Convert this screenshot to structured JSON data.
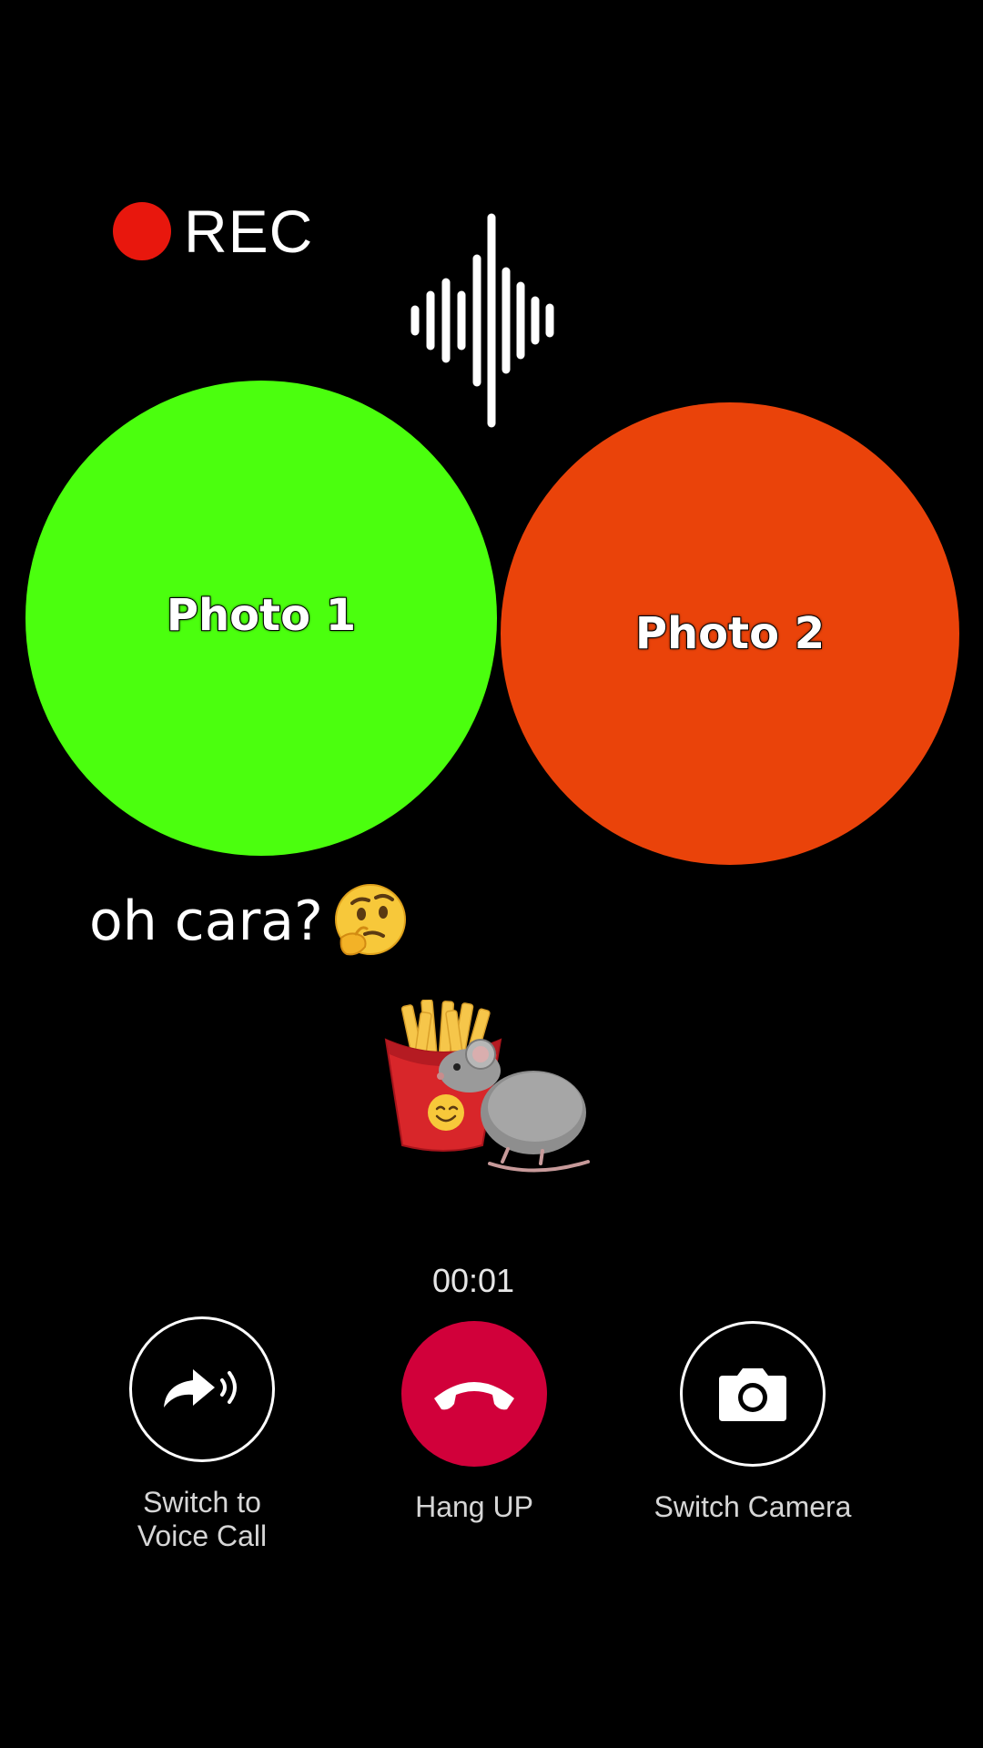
{
  "recording": {
    "label": "REC",
    "dot_color": "#e8170d"
  },
  "waveform": {
    "icon": "audio-waveform-icon"
  },
  "photos": [
    {
      "label": "Photo 1",
      "color": "#4bff0e"
    },
    {
      "label": "Photo 2",
      "color": "#ea430a"
    }
  ],
  "caption": {
    "text": "oh cara?",
    "emoji": "thinking-face-emoji"
  },
  "sticker": {
    "icon": "fries-and-rat-sticker"
  },
  "call": {
    "timer": "00:01",
    "controls": {
      "voice": {
        "label": "Switch to\nVoice Call",
        "icon": "share-audio-icon"
      },
      "hangup": {
        "label": "Hang UP",
        "icon": "phone-hangup-icon",
        "color": "#d1003a"
      },
      "camera": {
        "label": "Switch Camera",
        "icon": "camera-icon"
      }
    }
  }
}
